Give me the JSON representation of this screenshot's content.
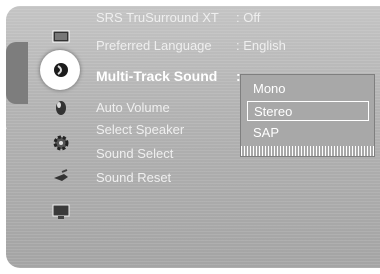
{
  "sidebar": {
    "tab_label": "Sound"
  },
  "icons": [
    "picture-icon",
    "sound-icon",
    "channel-icon",
    "setup-icon",
    "input-icon",
    "application-icon"
  ],
  "menu": {
    "items": [
      {
        "label": "SRS TruSurround XT",
        "value": ": Off"
      },
      {
        "label": "Preferred Language",
        "value": ": English"
      },
      {
        "label": "Multi-Track Sound",
        "value": ":"
      },
      {
        "label": "Auto Volume",
        "value": ""
      },
      {
        "label": "Select Speaker",
        "value": ""
      },
      {
        "label": "Sound Select",
        "value": ""
      },
      {
        "label": "Sound Reset",
        "value": ""
      }
    ]
  },
  "popup": {
    "options": [
      "Mono",
      "Stereo",
      "SAP"
    ],
    "selected": "Stereo"
  },
  "colors": {
    "panel": "#b2b2b2",
    "text": "#efefef",
    "highlight": "#ffffff"
  }
}
